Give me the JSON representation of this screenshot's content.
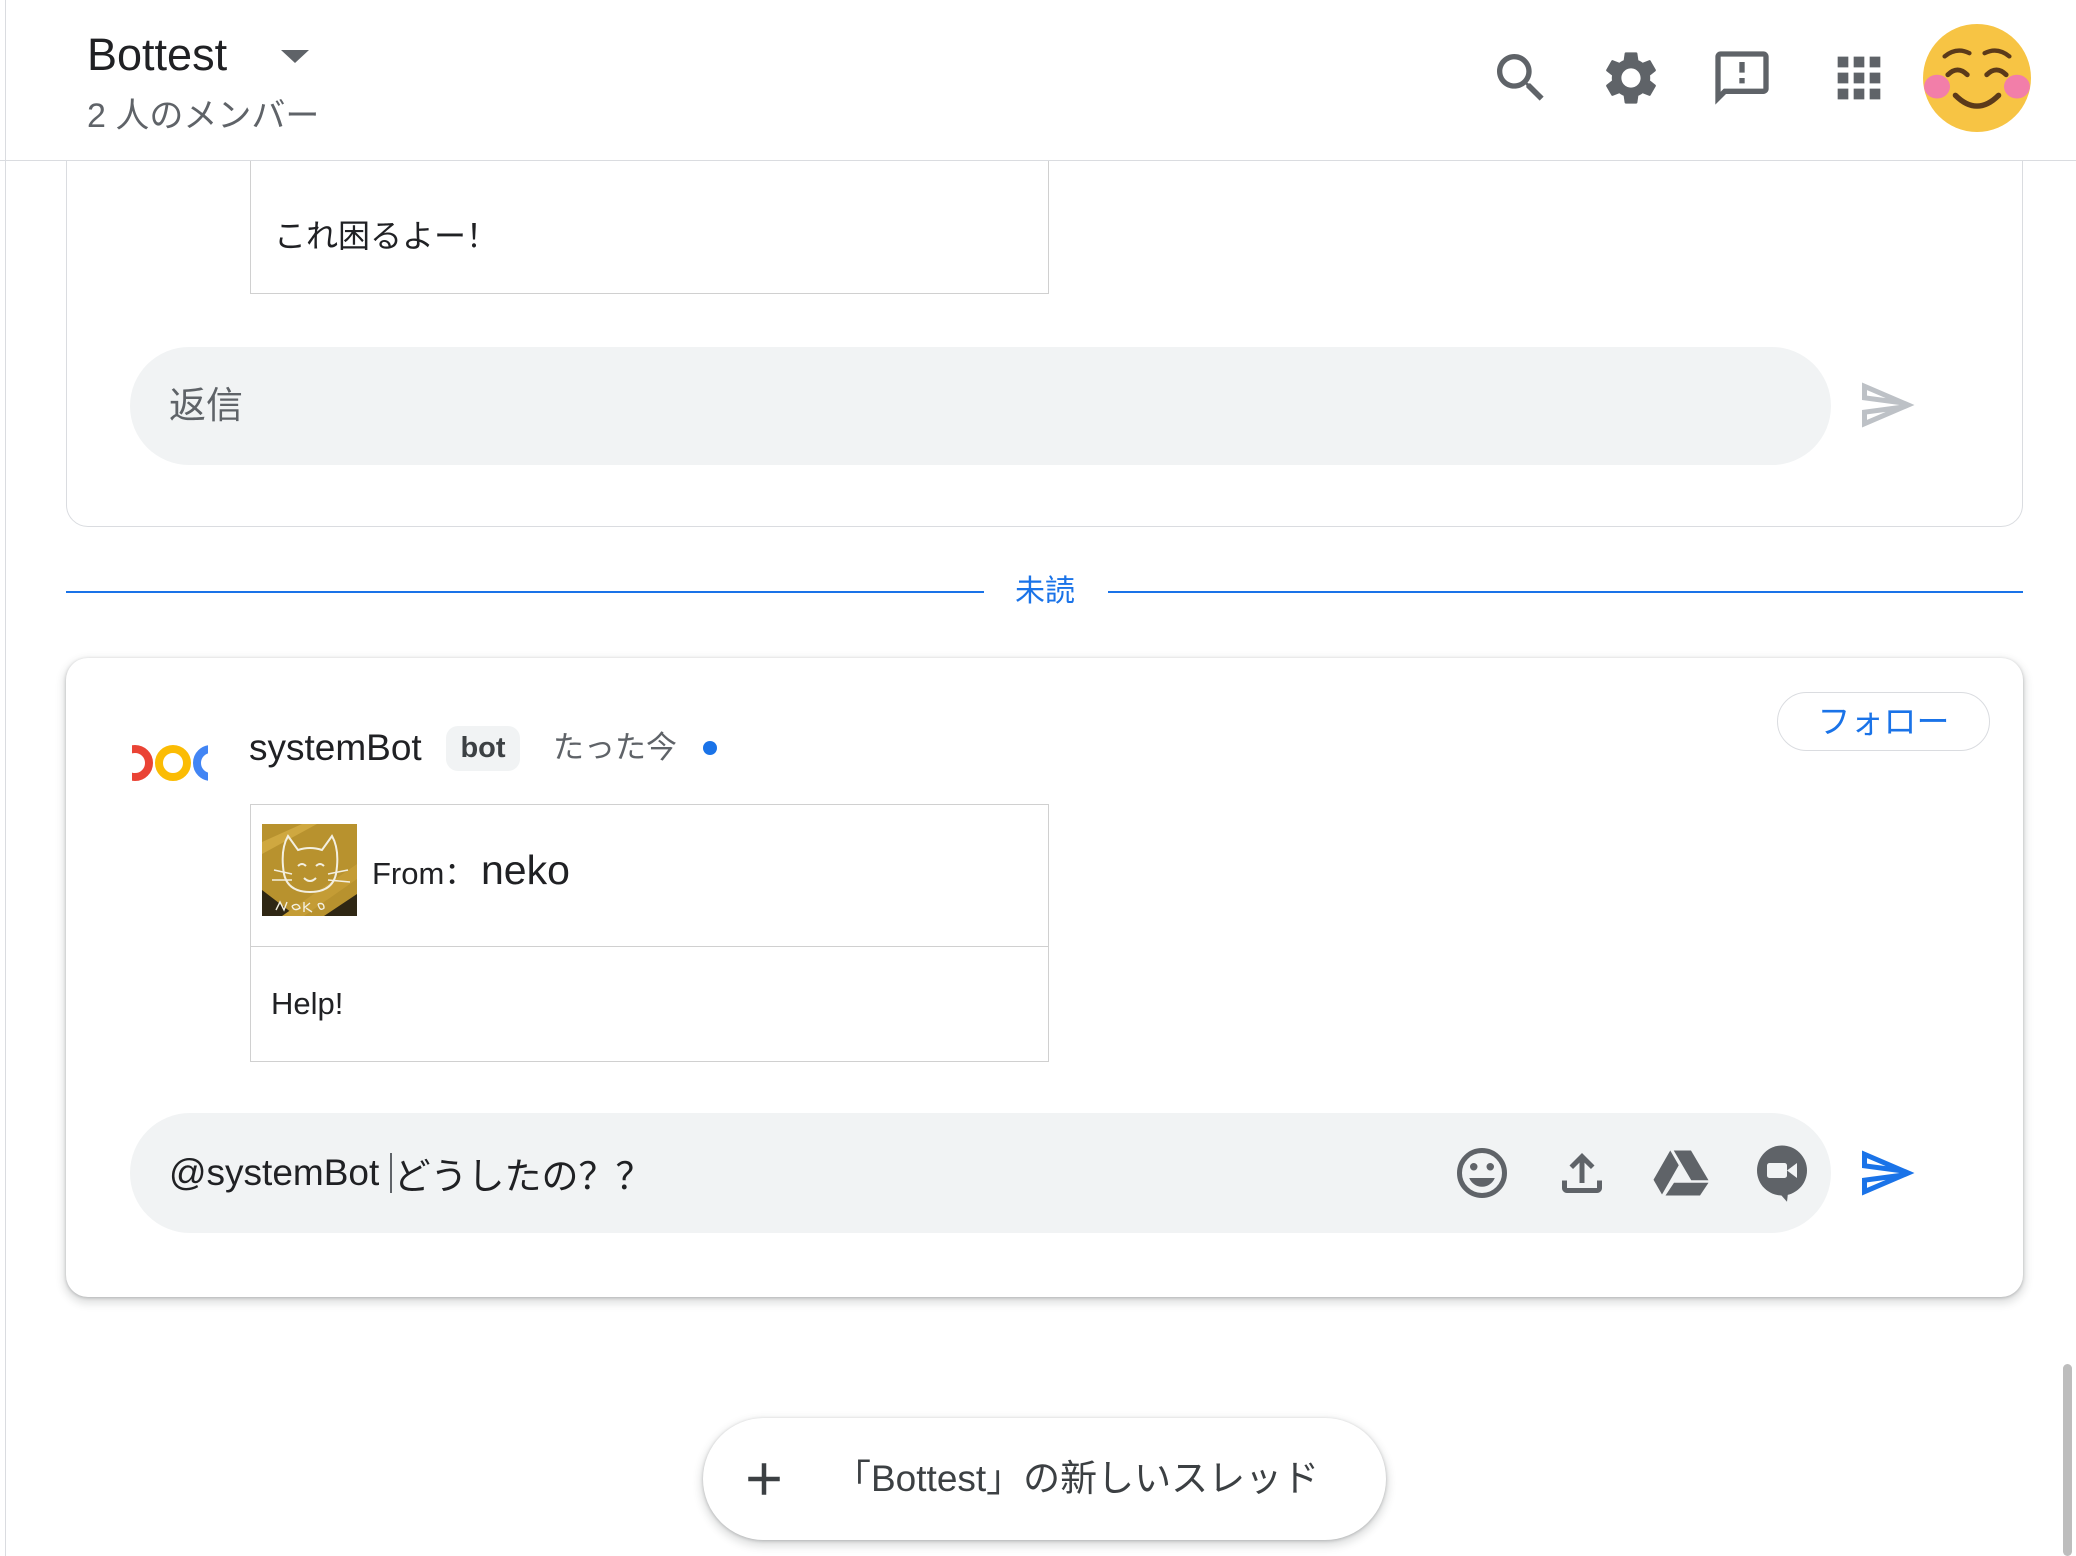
{
  "header": {
    "title": "Bottest",
    "subtitle": "2 人のメンバー",
    "icons": {
      "dropdown": "caret-down-icon",
      "search": "search-icon",
      "settings": "gear-icon",
      "feedback": "feedback-icon",
      "apps": "apps-grid-icon",
      "account": "smiling-face-avatar"
    }
  },
  "thread_previous": {
    "card_body": "これ困るよー！",
    "reply_placeholder": "返信",
    "send_icon": "send-icon"
  },
  "unread_divider": {
    "label": "未読"
  },
  "thread_latest": {
    "sender_name": "systemBot",
    "sender_badge": "bot",
    "timestamp": "たった今",
    "follow_button": "フォロー",
    "card": {
      "from_label": "From：",
      "from_name": "neko",
      "body": "Help!"
    },
    "compose": {
      "mention": "@systemBot ",
      "text": "どうしたの？？",
      "icons": [
        "emoji-icon",
        "upload-icon",
        "google-drive-icon",
        "video-meeting-icon",
        "send-icon"
      ]
    }
  },
  "new_thread_button": {
    "icon": "plus-icon",
    "label": "「Bottest」の新しいスレッド"
  },
  "colors": {
    "accent": "#1a73e8",
    "text_primary": "#202124",
    "text_secondary": "#5f6368",
    "input_background": "#f1f3f4",
    "border": "#dadce0",
    "avatar_yellow": "#f7c444"
  }
}
